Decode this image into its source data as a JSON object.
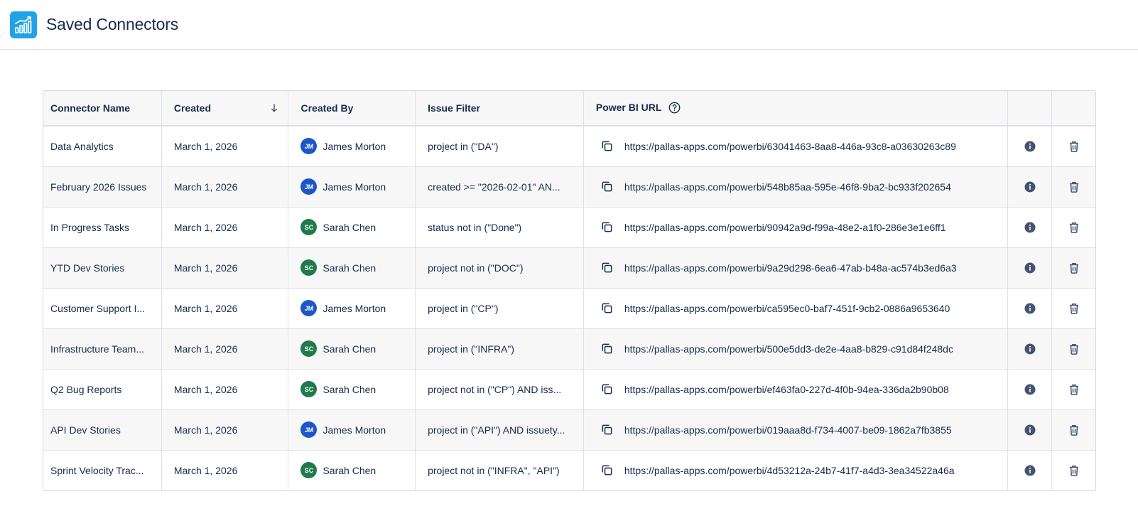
{
  "page": {
    "title": "Saved Connectors"
  },
  "colors": {
    "logo": "#1fa3e8",
    "avatar_jm": "#1c57c7",
    "avatar_sc": "#1f7a4c"
  },
  "table": {
    "headers": {
      "name": "Connector Name",
      "created": "Created",
      "created_by": "Created By",
      "filter": "Issue Filter",
      "url": "Power BI URL"
    },
    "sort_icon": "arrow-down-icon",
    "rows": [
      {
        "name": "Data Analytics",
        "created": "March 1, 2026",
        "initials": "JM",
        "user": "James Morton",
        "filter": "project in (\"DA\")",
        "url": "https://pallas-apps.com/powerbi/63041463-8aa8-446a-93c8-a03630263c89"
      },
      {
        "name": "February 2026 Issues",
        "created": "March 1, 2026",
        "initials": "JM",
        "user": "James Morton",
        "filter": "created >= \"2026-02-01\" AN...",
        "url": "https://pallas-apps.com/powerbi/548b85aa-595e-46f8-9ba2-bc933f202654"
      },
      {
        "name": "In Progress Tasks",
        "created": "March 1, 2026",
        "initials": "SC",
        "user": "Sarah Chen",
        "filter": "status not in (\"Done\")",
        "url": "https://pallas-apps.com/powerbi/90942a9d-f99a-48e2-a1f0-286e3e1e6ff1"
      },
      {
        "name": "YTD Dev Stories",
        "created": "March 1, 2026",
        "initials": "SC",
        "user": "Sarah Chen",
        "filter": "project not in (\"DOC\")",
        "url": "https://pallas-apps.com/powerbi/9a29d298-6ea6-47ab-b48a-ac574b3ed6a3"
      },
      {
        "name": "Customer Support I...",
        "created": "March 1, 2026",
        "initials": "JM",
        "user": "James Morton",
        "filter": "project in (\"CP\")",
        "url": "https://pallas-apps.com/powerbi/ca595ec0-baf7-451f-9cb2-0886a9653640"
      },
      {
        "name": "Infrastructure Team...",
        "created": "March 1, 2026",
        "initials": "SC",
        "user": "Sarah Chen",
        "filter": "project in (\"INFRA\")",
        "url": "https://pallas-apps.com/powerbi/500e5dd3-de2e-4aa8-b829-c91d84f248dc"
      },
      {
        "name": "Q2 Bug Reports",
        "created": "March 1, 2026",
        "initials": "SC",
        "user": "Sarah Chen",
        "filter": "project not in (\"CP\") AND iss...",
        "url": "https://pallas-apps.com/powerbi/ef463fa0-227d-4f0b-94ea-336da2b90b08"
      },
      {
        "name": "API Dev Stories",
        "created": "March 1, 2026",
        "initials": "JM",
        "user": "James Morton",
        "filter": "project in (\"API\") AND issuety...",
        "url": "https://pallas-apps.com/powerbi/019aaa8d-f734-4007-be09-1862a7fb3855"
      },
      {
        "name": "Sprint Velocity Trac...",
        "created": "March 1, 2026",
        "initials": "SC",
        "user": "Sarah Chen",
        "filter": "project not in (\"INFRA\", \"API\")",
        "url": "https://pallas-apps.com/powerbi/4d53212a-24b7-41f7-a4d3-3ea34522a46a"
      }
    ]
  }
}
